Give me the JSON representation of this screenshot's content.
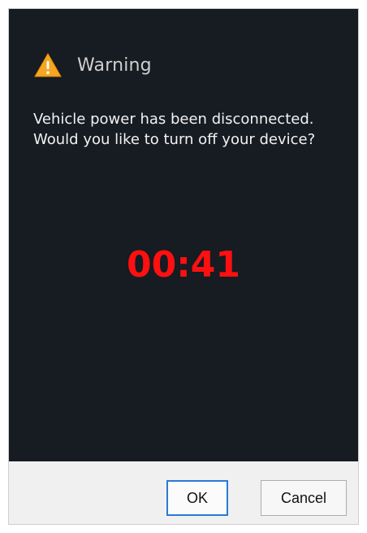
{
  "dialog": {
    "title": "Warning",
    "icon": "warning-icon",
    "message_lines": [
      "Vehicle power has been disconnected.",
      "Would you like to turn off your device?"
    ],
    "countdown": "00:41",
    "countdown_color": "#ff1010",
    "buttons": {
      "ok": "OK",
      "cancel": "Cancel"
    },
    "colors": {
      "content_background": "#171b22",
      "footer_background": "#f0f0f0",
      "primary_button_border": "#2a7ad6",
      "warning_icon_fill": "#f5a623"
    }
  }
}
